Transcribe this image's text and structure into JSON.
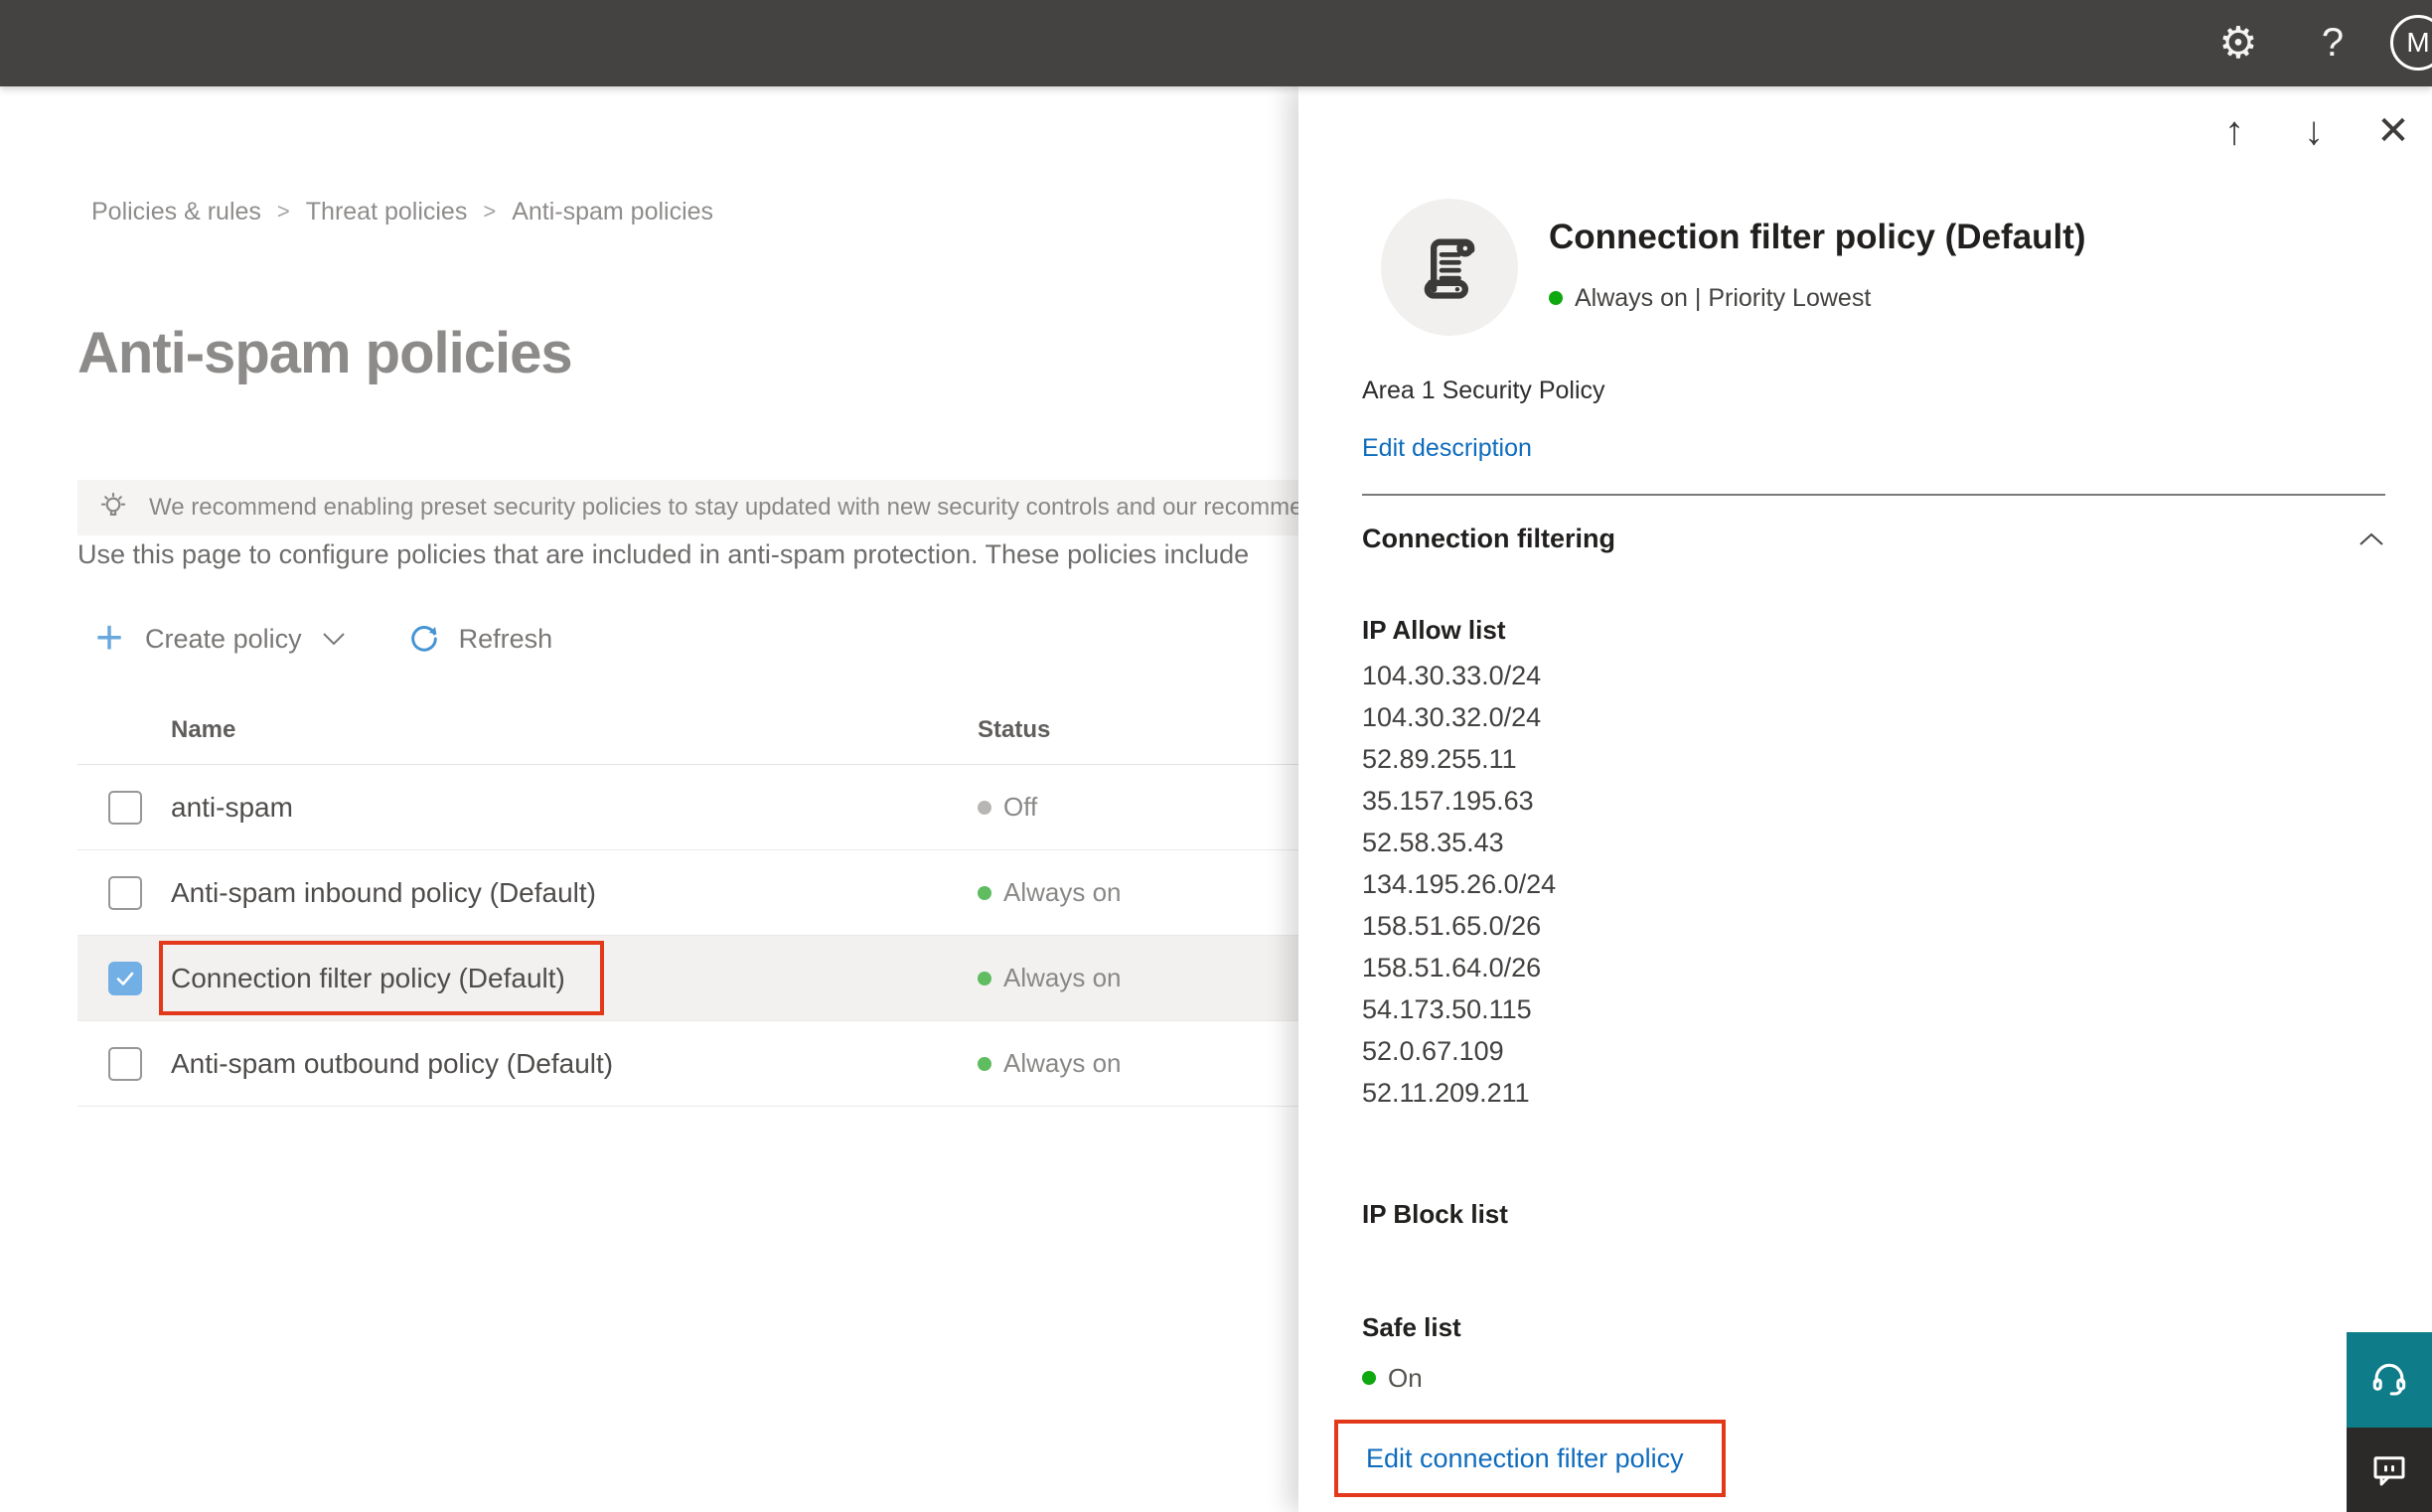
{
  "topbar": {
    "avatar_initial": "M"
  },
  "icons": {
    "gear": "⚙",
    "help": "?",
    "up_arrow": "↑",
    "down_arrow": "↓",
    "close": "✕",
    "plus": "+",
    "breadcrumb_separator": ">"
  },
  "breadcrumb": {
    "items": [
      "Policies & rules",
      "Threat policies",
      "Anti-spam policies"
    ]
  },
  "page": {
    "title": "Anti-spam policies",
    "banner_text": "We recommend enabling preset security policies to stay updated with new security controls and our recomme",
    "description": "Use this page to configure policies that are included in anti-spam protection. These policies include",
    "toolbar": {
      "create_policy_label": "Create policy",
      "refresh_label": "Refresh"
    }
  },
  "table": {
    "columns": {
      "name": "Name",
      "status": "Status"
    },
    "rows": [
      {
        "name": "anti-spam",
        "status": "Off",
        "checked": false,
        "selected": false
      },
      {
        "name": "Anti-spam inbound policy (Default)",
        "status": "Always on",
        "checked": false,
        "selected": false
      },
      {
        "name": "Connection filter policy (Default)",
        "status": "Always on",
        "checked": true,
        "selected": true
      },
      {
        "name": "Anti-spam outbound policy (Default)",
        "status": "Always on",
        "checked": false,
        "selected": false
      }
    ]
  },
  "flyout": {
    "title": "Connection filter policy (Default)",
    "status_line": "Always on | Priority Lowest",
    "description": "Area 1 Security Policy",
    "edit_description_label": "Edit description",
    "section_title": "Connection filtering",
    "ip_allow_title": "IP Allow list",
    "ip_allow_list": [
      "104.30.33.0/24",
      "104.30.32.0/24",
      "52.89.255.11",
      "35.157.195.63",
      "52.58.35.43",
      "134.195.26.0/24",
      "158.51.65.0/26",
      "158.51.64.0/26",
      "54.173.50.115",
      "52.0.67.109",
      "52.11.209.211"
    ],
    "ip_block_title": "IP Block list",
    "safe_list_title": "Safe list",
    "safe_list_status": "On",
    "edit_policy_label": "Edit connection filter policy"
  },
  "colors": {
    "topbar_bg": "#454341",
    "accent_blue": "#0f6cbd",
    "toolbar_blue": "#69a8dc",
    "status_green": "#5fbc5f",
    "status_green_bright": "#0fa80f",
    "status_gray": "#b8b6b4",
    "annotation_red": "#e3391b",
    "checkbox_checked_blue": "#71afe5",
    "support_teal": "#0e7d89",
    "feedback_dark": "#2b2a28"
  }
}
